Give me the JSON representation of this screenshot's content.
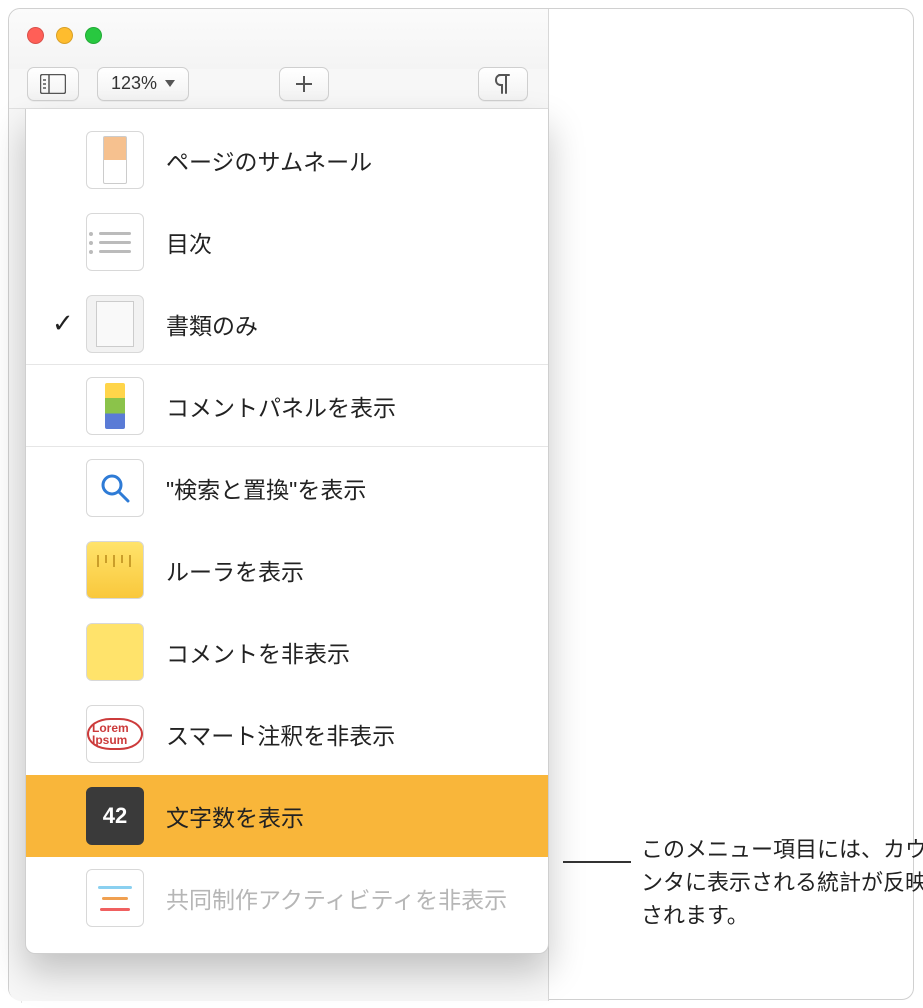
{
  "toolbar": {
    "zoom_level": "123%"
  },
  "menu": {
    "page_thumbnails": "ページのサムネール",
    "table_of_contents": "目次",
    "document_only": "書類のみ",
    "show_comment_panel": "コメントパネルを表示",
    "show_find_replace": "\"検索と置換\"を表示",
    "show_ruler": "ルーラを表示",
    "hide_comments": "コメントを非表示",
    "hide_smart_annotations": "スマート注釈を非表示",
    "show_char_count": "文字数を表示",
    "char_count_icon_value": "42",
    "hide_collab_activity": "共同制作アクティビティを非表示"
  },
  "callout": "このメニュー項目には、カウンタに表示される統計が反映されます。",
  "smart_icon_text": "Lorem Ipsum"
}
